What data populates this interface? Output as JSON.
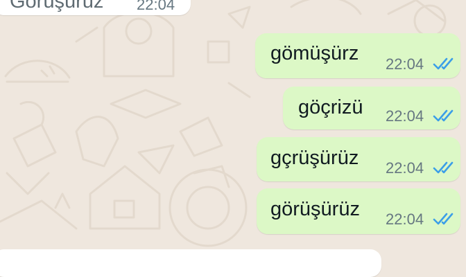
{
  "chat": {
    "incoming_top": {
      "text": "Görüşürüz",
      "time": "22:04"
    },
    "outgoing": [
      {
        "text": "gömüşürz",
        "time": "22:04",
        "status": "read"
      },
      {
        "text": "göçrizü",
        "time": "22:04",
        "status": "read"
      },
      {
        "text": "gçrüşürüz",
        "time": "22:04",
        "status": "read"
      },
      {
        "text": "görüşürüz",
        "time": "22:04",
        "status": "read"
      }
    ]
  },
  "colors": {
    "wallpaper": "#efe7de",
    "outgoing_bubble": "#dcf8c6",
    "incoming_bubble": "#ffffff",
    "read_ticks": "#3b9ee8",
    "timestamp": "#667781"
  },
  "icons": {
    "read_status": "double-check-icon"
  }
}
